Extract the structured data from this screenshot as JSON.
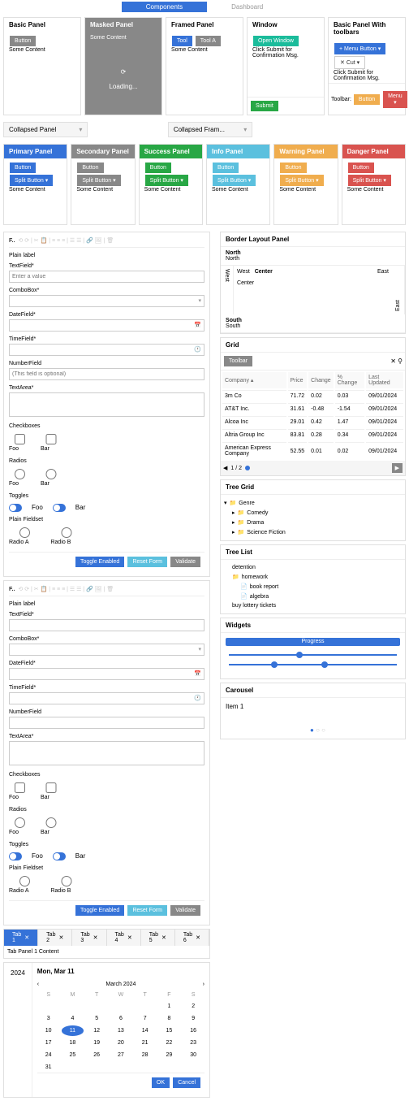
{
  "topTabs": {
    "active": "Components",
    "inactive": "Dashboard"
  },
  "panels": {
    "basic": {
      "title": "Basic Panel",
      "btn": "Button",
      "content": "Some Content"
    },
    "masked": {
      "title": "Masked Panel",
      "content": "Some Content",
      "loading": "Loading..."
    },
    "framed": {
      "title": "Framed Panel",
      "btn1": "Tool",
      "btn2": "Tool A",
      "content": "Some Content"
    },
    "window": {
      "title": "Window",
      "btn": "Open Window",
      "content": "Click Submit for Confirmation Msg.",
      "submit": "Submit"
    },
    "toolbars": {
      "title": "Basic Panel With toolbars",
      "menuBtn": "Menu Button",
      "cutBtn": "Cut",
      "content": "Click Submit for Confirmation Msg.",
      "toolbarLabel": "Toolbar:",
      "btn": "Button",
      "menu": "Menu",
      "split": "Split Button"
    },
    "collapsed": "Collapsed Panel",
    "collapsedFramed": "Collapsed Fram..."
  },
  "colorPanels": {
    "primary": "Primary Panel",
    "secondary": "Secondary Panel",
    "success": "Success Panel",
    "info": "Info Panel",
    "warning": "Warning Panel",
    "danger": "Danger Panel",
    "btn": "Button",
    "split": "Split Button",
    "content": "Some Content"
  },
  "form": {
    "title": "F..",
    "plainLabel": "Plain label",
    "textfield": "TextField*",
    "textfieldPh": "Enter a value",
    "combobox": "ComboBox*",
    "datefield": "DateField*",
    "timefield": "TimeField*",
    "numberfield": "NumberField",
    "numberfieldPh": "(This field is optional)",
    "textarea": "TextArea*",
    "checkboxes": "Checkboxes",
    "foo": "Foo",
    "bar": "Bar",
    "radios": "Radios",
    "toggles": "Toggles",
    "fieldset": "Plain Fieldset",
    "radioA": "Radio A",
    "radioB": "Radio B",
    "toggleEnabled": "Toggle Enabled",
    "resetForm": "Reset Form",
    "validate": "Validate"
  },
  "borderLayout": {
    "title": "Border Layout Panel",
    "north": "North",
    "south": "South",
    "west": "West",
    "east": "East",
    "center": "Center"
  },
  "grid": {
    "title": "Grid",
    "toolbar": "Toolbar",
    "cols": [
      "Company",
      "Price",
      "Change",
      "% Change",
      "Last Updated"
    ],
    "rows": [
      [
        "3m Co",
        "71.72",
        "0.02",
        "0.03",
        "09/01/2024"
      ],
      [
        "AT&T Inc.",
        "31.61",
        "-0.48",
        "-1.54",
        "09/01/2024"
      ],
      [
        "Alcoa Inc",
        "29.01",
        "0.42",
        "1.47",
        "09/01/2024"
      ],
      [
        "Altria Group Inc",
        "83.81",
        "0.28",
        "0.34",
        "09/01/2024"
      ],
      [
        "American Express Company",
        "52.55",
        "0.01",
        "0.02",
        "09/01/2024"
      ]
    ],
    "pager": "1 / 2"
  },
  "treeGrid": {
    "title": "Tree Grid",
    "root": "Genre",
    "items": [
      "Comedy",
      "Drama",
      "Science Fiction"
    ]
  },
  "treeList": {
    "title": "Tree List",
    "items": [
      "detention",
      "homework",
      "book report",
      "algebra",
      "buy lottery tickets"
    ]
  },
  "widgets": {
    "title": "Widgets",
    "progress": "Progress"
  },
  "carousel": {
    "title": "Carousel",
    "item": "Item 1"
  },
  "tabPanel": {
    "tabs": [
      "Tab 1",
      "Tab 2",
      "Tab 3",
      "Tab 4",
      "Tab 5",
      "Tab 6"
    ],
    "content": "Tab Panel 1 Content"
  },
  "datePicker": {
    "year": "2024",
    "selected": "Mon, Mar 11",
    "month": "March 2024",
    "dow": [
      "S",
      "M",
      "T",
      "W",
      "T",
      "F",
      "S"
    ],
    "days": [
      [
        "",
        "",
        "",
        "",
        "",
        "1",
        "2"
      ],
      [
        "3",
        "4",
        "5",
        "6",
        "7",
        "8",
        "9"
      ],
      [
        "10",
        "11",
        "12",
        "13",
        "14",
        "15",
        "16"
      ],
      [
        "17",
        "18",
        "19",
        "20",
        "21",
        "22",
        "23"
      ],
      [
        "24",
        "25",
        "26",
        "27",
        "28",
        "29",
        "30"
      ],
      [
        "31",
        "",
        "",
        "",
        "",
        "",
        ""
      ]
    ],
    "selDay": "11",
    "ok": "OK",
    "cancel": "Cancel"
  }
}
